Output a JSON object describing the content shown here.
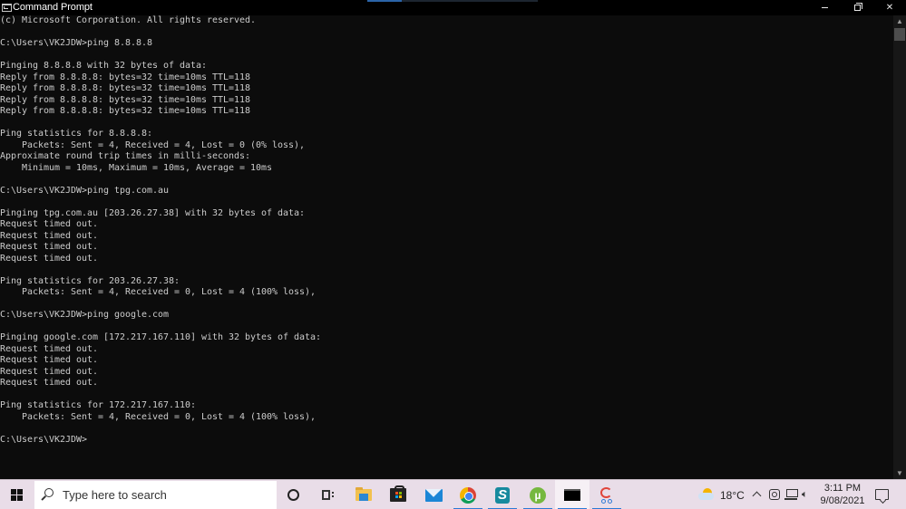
{
  "window": {
    "title": "Command Prompt",
    "icon": "cmd-icon",
    "controls": {
      "minimize": "minimize-icon",
      "maximize": "restore-icon",
      "close": "close-icon"
    }
  },
  "console": {
    "foreground": "#cccccc",
    "background": "#0c0c0c",
    "lines": [
      "(c) Microsoft Corporation. All rights reserved.",
      "",
      "C:\\Users\\VK2JDW>ping 8.8.8.8",
      "",
      "Pinging 8.8.8.8 with 32 bytes of data:",
      "Reply from 8.8.8.8: bytes=32 time=10ms TTL=118",
      "Reply from 8.8.8.8: bytes=32 time=10ms TTL=118",
      "Reply from 8.8.8.8: bytes=32 time=10ms TTL=118",
      "Reply from 8.8.8.8: bytes=32 time=10ms TTL=118",
      "",
      "Ping statistics for 8.8.8.8:",
      "    Packets: Sent = 4, Received = 4, Lost = 0 (0% loss),",
      "Approximate round trip times in milli-seconds:",
      "    Minimum = 10ms, Maximum = 10ms, Average = 10ms",
      "",
      "C:\\Users\\VK2JDW>ping tpg.com.au",
      "",
      "Pinging tpg.com.au [203.26.27.38] with 32 bytes of data:",
      "Request timed out.",
      "Request timed out.",
      "Request timed out.",
      "Request timed out.",
      "",
      "Ping statistics for 203.26.27.38:",
      "    Packets: Sent = 4, Received = 0, Lost = 4 (100% loss),",
      "",
      "C:\\Users\\VK2JDW>ping google.com",
      "",
      "Pinging google.com [172.217.167.110] with 32 bytes of data:",
      "Request timed out.",
      "Request timed out.",
      "Request timed out.",
      "Request timed out.",
      "",
      "Ping statistics for 172.217.167.110:",
      "    Packets: Sent = 4, Received = 0, Lost = 4 (100% loss),",
      "",
      "C:\\Users\\VK2JDW>"
    ]
  },
  "scrollbar": {
    "up": "chevron-up-icon",
    "down": "chevron-down-icon",
    "position": 0
  },
  "taskbar": {
    "search_placeholder": "Type here to search",
    "apps": [
      {
        "name": "cortana",
        "active": false,
        "running": false
      },
      {
        "name": "task-view",
        "active": false,
        "running": false
      },
      {
        "name": "file-explorer",
        "active": false,
        "running": false
      },
      {
        "name": "microsoft-store",
        "active": false,
        "running": false
      },
      {
        "name": "mail",
        "active": false,
        "running": false
      },
      {
        "name": "chrome",
        "active": false,
        "running": true
      },
      {
        "name": "surfshark",
        "active": false,
        "running": true
      },
      {
        "name": "utorrent",
        "active": false,
        "running": true
      },
      {
        "name": "command-prompt",
        "active": true,
        "running": true
      },
      {
        "name": "snip-sketch",
        "active": false,
        "running": true
      }
    ],
    "tray": {
      "temperature": "18°C",
      "time": "3:11 PM",
      "date": "9/08/2021"
    },
    "colors": {
      "background": "#e9dde8",
      "indicator": "#2b7ad6"
    }
  }
}
